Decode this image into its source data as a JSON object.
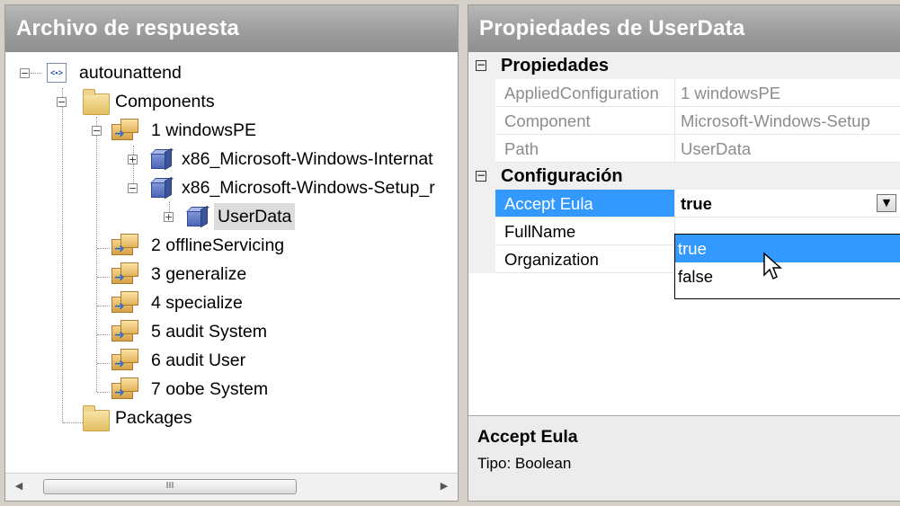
{
  "left": {
    "title": "Archivo de respuesta",
    "tree": {
      "root": "autounattend",
      "components": "Components",
      "passes": [
        "1 windowsPE",
        "2 offlineServicing",
        "3 generalize",
        "4 specialize",
        "5 audit System",
        "6 audit User",
        "7 oobe System"
      ],
      "windowspe_children": [
        "x86_Microsoft-Windows-Internat",
        "x86_Microsoft-Windows-Setup_r"
      ],
      "userdata": "UserData",
      "packages": "Packages"
    },
    "scroll_grip": "III"
  },
  "right": {
    "title": "Propiedades de UserData",
    "categories": {
      "properties": "Propiedades",
      "config": "Configuración"
    },
    "props": [
      {
        "name": "AppliedConfiguration",
        "value": "1 windowsPE"
      },
      {
        "name": "Component",
        "value": "Microsoft-Windows-Setup"
      },
      {
        "name": "Path",
        "value": "UserData"
      }
    ],
    "config": [
      {
        "name": "Accept Eula",
        "value": "true"
      },
      {
        "name": "FullName",
        "value": ""
      },
      {
        "name": "Organization",
        "value": ""
      }
    ],
    "dropdown_options": [
      "true",
      "false"
    ],
    "description": {
      "title": "Accept Eula",
      "text": "Tipo: Boolean"
    }
  },
  "colors": {
    "selection": "#3399ff",
    "title_bar": "#9d9d9d"
  }
}
